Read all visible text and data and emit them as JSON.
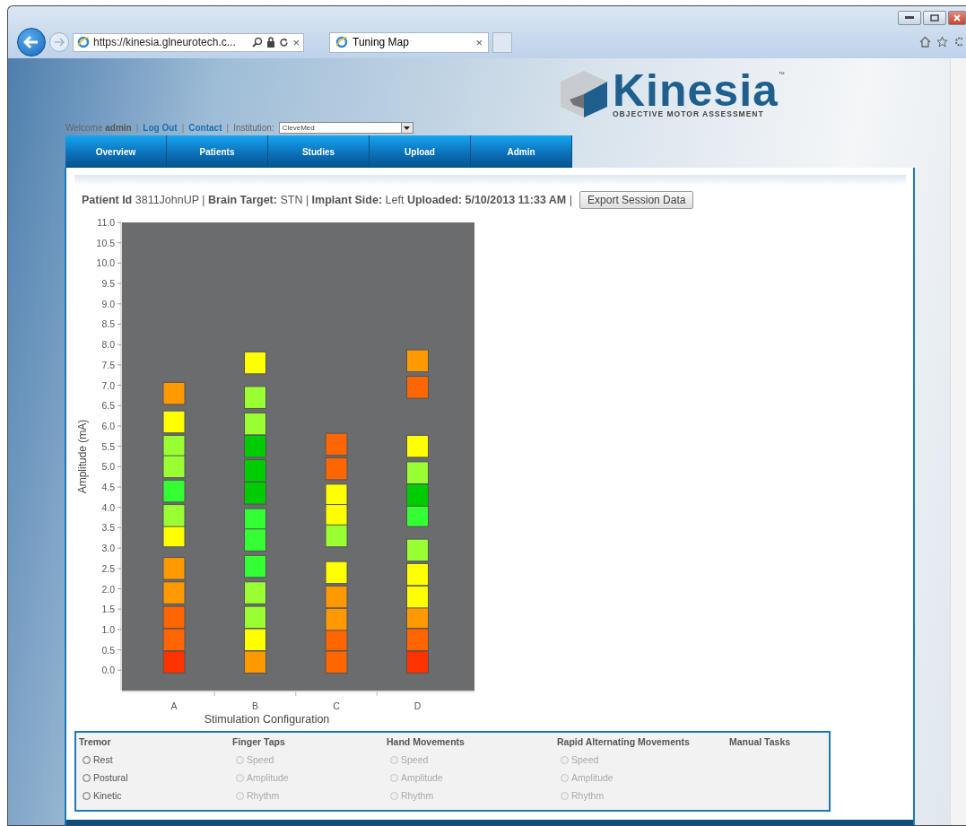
{
  "browser": {
    "address": "https://kinesia.glneurotech.c...",
    "tab": {
      "title": "Tuning Map",
      "close": "×"
    },
    "address_close": "×"
  },
  "header": {
    "logo": {
      "name": "Kinesia",
      "tm": "™",
      "tagline": "OBJECTIVE MOTOR ASSESSMENT"
    },
    "welcome": "Welcome **admin**",
    "links": [
      "Log Out",
      "Contact"
    ],
    "separator": "|",
    "institution_label": "Institution:",
    "institution": "CleveMed"
  },
  "nav": [
    "Overview",
    "Patients",
    "Studies",
    "Upload",
    "Admin"
  ],
  "info": "**Patient Id** 3811JohnUP | **Brain Target:** STN | **Implant Side:** Left **Uploaded: 5/10/2013 11:33 AM** |",
  "export_button": "Export Session Data",
  "chart_data": {
    "type": "scatter",
    "xlabel": "Stimulation Configuration",
    "ylabel": "Amplitude (mA)",
    "categories": [
      "A",
      "B",
      "C",
      "D"
    ],
    "ylim": [
      -0.5,
      11.0
    ],
    "yticks": [
      {
        "value": 0,
        "label": "0.0"
      },
      {
        "value": 0.5,
        "label": "0.5"
      },
      {
        "value": 1,
        "label": "1.0"
      },
      {
        "value": 1.5,
        "label": "1.5"
      },
      {
        "value": 2,
        "label": "2.0"
      },
      {
        "value": 2.5,
        "label": "2.5"
      },
      {
        "value": 3,
        "label": "3.0"
      },
      {
        "value": 3.5,
        "label": "3.5"
      },
      {
        "value": 4,
        "label": "4.0"
      },
      {
        "value": 4.5,
        "label": "4.5"
      },
      {
        "value": 5,
        "label": "5.0"
      },
      {
        "value": 5.5,
        "label": "5.5"
      },
      {
        "value": 6,
        "label": "6.0"
      },
      {
        "value": 6.5,
        "label": "6.5"
      },
      {
        "value": 7,
        "label": "7.0"
      },
      {
        "value": 7.5,
        "label": "7.5"
      },
      {
        "value": 8,
        "label": "8.0"
      },
      {
        "value": 8.5,
        "label": "8.5"
      },
      {
        "value": 9,
        "label": "9.0"
      },
      {
        "value": 9.5,
        "label": "9.5"
      },
      {
        "value": 10,
        "label": "10.0"
      },
      {
        "value": 10.5,
        "label": "10.5"
      },
      {
        "value": 11,
        "label": "11.0"
      }
    ],
    "series": [
      {
        "color": "#ff3300",
        "x": [
          "A",
          "D"
        ],
        "values": [
          0.2,
          0.2
        ]
      },
      {
        "color": "#ff6600",
        "x": [
          "A",
          "A",
          "C",
          "C",
          "C",
          "C",
          "D",
          "D"
        ],
        "values": [
          1.3,
          0.75,
          5.55,
          4.95,
          0.75,
          0.2,
          6.95,
          0.75
        ]
      },
      {
        "color": "#ff9900",
        "x": [
          "A",
          "A",
          "A",
          "B",
          "C",
          "C",
          "D",
          "D"
        ],
        "values": [
          6.8,
          2.5,
          1.9,
          0.2,
          1.8,
          1.25,
          7.6,
          1.3
        ]
      },
      {
        "color": "#ffff00",
        "x": [
          "A",
          "A",
          "B",
          "B",
          "C",
          "C",
          "C",
          "D",
          "D",
          "D"
        ],
        "values": [
          6.1,
          3.3,
          7.55,
          0.75,
          4.3,
          3.8,
          2.4,
          5.5,
          2.35,
          1.8
        ]
      },
      {
        "color": "#99ff33",
        "x": [
          "A",
          "A",
          "A",
          "B",
          "B",
          "B",
          "B",
          "C",
          "D",
          "D"
        ],
        "values": [
          5.5,
          5.0,
          3.8,
          6.7,
          6.05,
          1.9,
          1.3,
          3.3,
          4.85,
          2.95
        ]
      },
      {
        "color": "#33ff33",
        "x": [
          "A",
          "B",
          "B",
          "B",
          "D"
        ],
        "values": [
          4.4,
          3.7,
          3.2,
          2.55,
          3.8
        ]
      },
      {
        "color": "#00cc00",
        "x": [
          "B",
          "B",
          "B",
          "D"
        ],
        "values": [
          5.5,
          4.9,
          4.35,
          4.3
        ]
      }
    ]
  },
  "groups": [
    {
      "title": "Tremor",
      "options": [
        {
          "label": "Rest",
          "checked": false,
          "disabled": false
        },
        {
          "label": "Postural",
          "checked": false,
          "disabled": false
        },
        {
          "label": "Kinetic",
          "checked": false,
          "disabled": false
        }
      ]
    },
    {
      "title": "Finger Taps",
      "options": [
        {
          "label": "Speed",
          "checked": false,
          "disabled": true
        },
        {
          "label": "Amplitude",
          "checked": false,
          "disabled": true
        },
        {
          "label": "Rhythm",
          "checked": false,
          "disabled": true
        }
      ]
    },
    {
      "title": "Hand Movements",
      "options": [
        {
          "label": "Speed",
          "checked": false,
          "disabled": true
        },
        {
          "label": "Amplitude",
          "checked": false,
          "disabled": true
        },
        {
          "label": "Rhythm",
          "checked": false,
          "disabled": true
        }
      ]
    },
    {
      "title": "Rapid Alternating Movements",
      "options": [
        {
          "label": "Speed",
          "checked": false,
          "disabled": true
        },
        {
          "label": "Amplitude",
          "checked": false,
          "disabled": true
        },
        {
          "label": "Rhythm",
          "checked": false,
          "disabled": true
        }
      ]
    },
    {
      "title": "Manual Tasks"
    }
  ]
}
